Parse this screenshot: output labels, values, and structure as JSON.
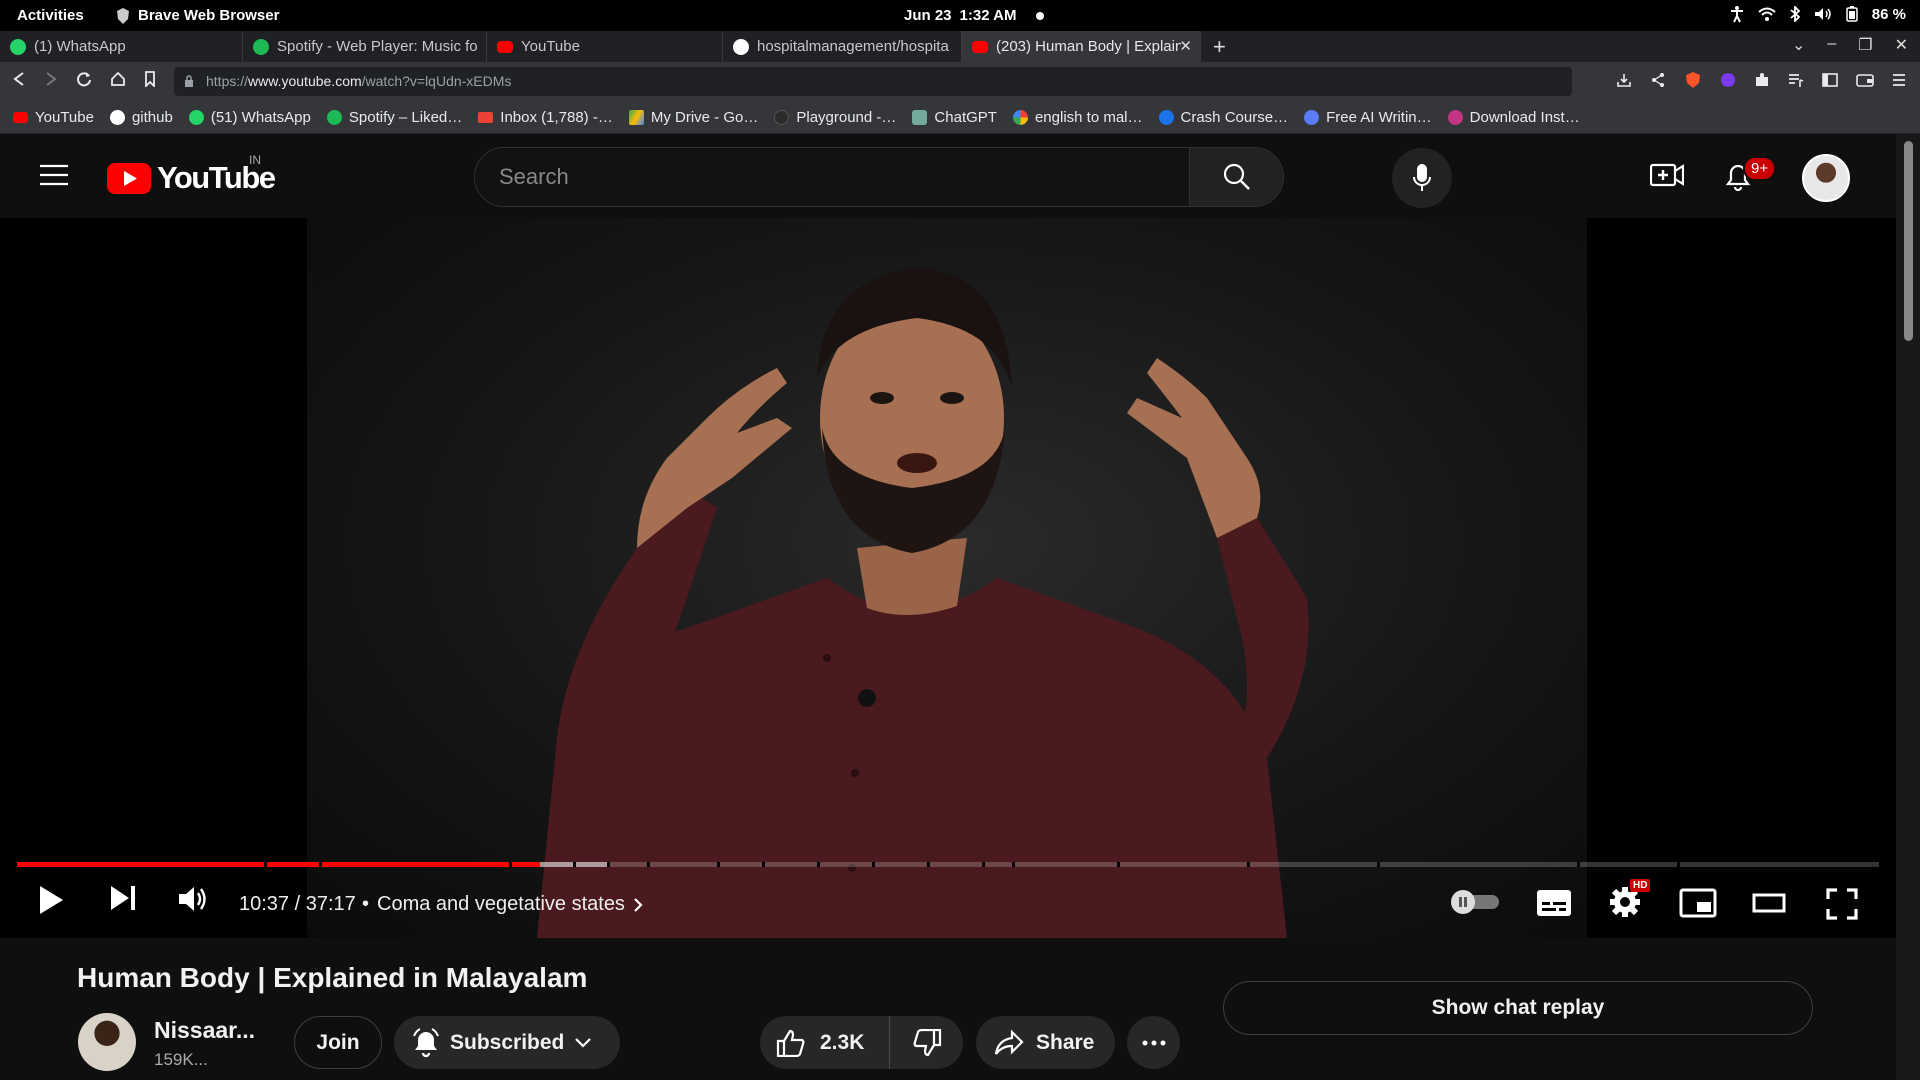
{
  "system_bar": {
    "activities": "Activities",
    "app_name": "Brave Web Browser",
    "date": "Jun 23",
    "time": "1:32 AM",
    "battery": "86 %"
  },
  "tabs": [
    {
      "label": "(1) WhatsApp",
      "favicon": "whatsapp-icon",
      "color": "#25d366"
    },
    {
      "label": "Spotify - Web Player: Music fo",
      "favicon": "spotify-icon",
      "color": "#1db954"
    },
    {
      "label": "YouTube",
      "favicon": "youtube-icon",
      "color": "#ff0000"
    },
    {
      "label": "hospitalmanagement/hospita",
      "favicon": "github-icon",
      "color": "#ffffff"
    },
    {
      "label": "(203) Human Body | Explain",
      "favicon": "youtube-icon",
      "color": "#ff0000",
      "active": true
    }
  ],
  "address_bar": {
    "url_prefix": "https://",
    "url_host": "www.youtube.com",
    "url_path": "/watch?v=lqUdn-xEDMs"
  },
  "bookmarks": [
    {
      "label": "YouTube",
      "icon": "youtube-icon",
      "color": "#ff0000"
    },
    {
      "label": "github",
      "icon": "github-icon",
      "color": "#ffffff"
    },
    {
      "label": "(51) WhatsApp",
      "icon": "whatsapp-icon",
      "color": "#25d366"
    },
    {
      "label": "Spotify – Liked…",
      "icon": "spotify-icon",
      "color": "#1db954"
    },
    {
      "label": "Inbox (1,788) -…",
      "icon": "gmail-icon",
      "color": "#ea4335"
    },
    {
      "label": "My Drive - Go…",
      "icon": "drive-icon",
      "color": "#fbbc04"
    },
    {
      "label": "Playground -…",
      "icon": "openai-icon",
      "color": "#2b2b2b"
    },
    {
      "label": "ChatGPT",
      "icon": "chatgpt-icon",
      "color": "#74aa9c"
    },
    {
      "label": "english to mal…",
      "icon": "google-icon",
      "color": "#4285f4"
    },
    {
      "label": "Crash Course…",
      "icon": "crashcourse-icon",
      "color": "#1a73e8"
    },
    {
      "label": "Free AI Writin…",
      "icon": "ai-writer-icon",
      "color": "#5b7cfa"
    },
    {
      "label": "Download Inst…",
      "icon": "download-icon",
      "color": "#c13584"
    }
  ],
  "youtube": {
    "logo_text": "YouTube",
    "country_code": "IN",
    "search_placeholder": "Search",
    "notification_count": "9+"
  },
  "player": {
    "time": "10:37 / 37:17",
    "chapter_separator": "•",
    "chapter": "Coma and vegetative states",
    "played_fraction": 0.281,
    "loaded_fraction": 0.318,
    "hd_badge": "HD"
  },
  "video": {
    "title": "Human Body | Explained in Malayalam",
    "channel_name": "Nissaar...",
    "channel_subs": "159K...",
    "join_label": "Join",
    "subscribed_label": "Subscribed",
    "like_count": "2.3K",
    "share_label": "Share",
    "chat_replay_label": "Show chat replay"
  }
}
